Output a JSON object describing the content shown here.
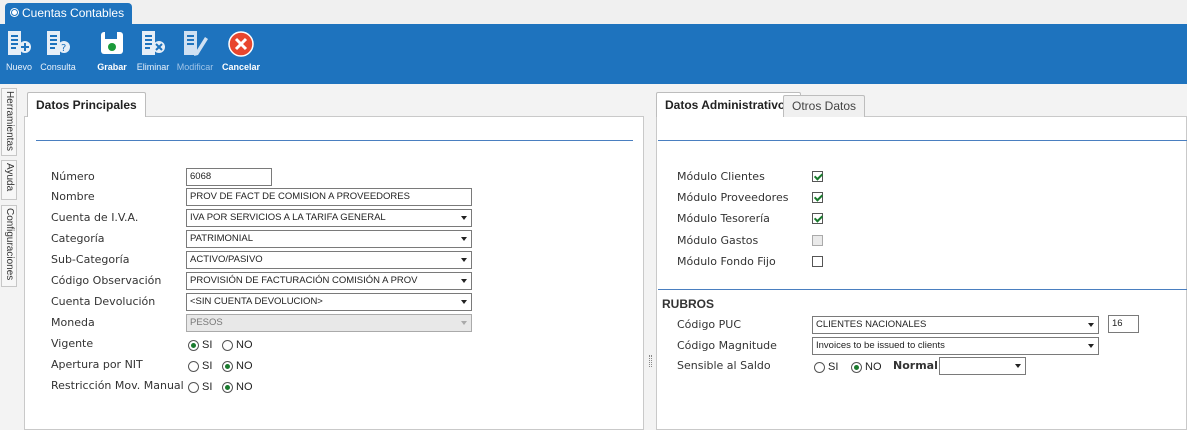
{
  "app": {
    "tab_title": "Cuentas Contables"
  },
  "toolbar": {
    "nuevo": "Nuevo",
    "consulta": "Consulta",
    "grabar": "Grabar",
    "eliminar": "Eliminar",
    "modificar": "Modificar",
    "cancelar": "Cancelar"
  },
  "side_tabs": {
    "herramientas": "Herramientas",
    "ayuda": "Ayuda",
    "configuraciones": "Configuraciones"
  },
  "left": {
    "tab": "Datos Principales",
    "labels": {
      "numero": "Número",
      "nombre": "Nombre",
      "cuenta_iva": "Cuenta de I.V.A.",
      "categoria": "Categoría",
      "subcategoria": "Sub-Categoría",
      "codigo_observacion": "Código Observación",
      "cuenta_devolucion": "Cuenta Devolución",
      "moneda": "Moneda",
      "vigente": "Vigente",
      "apertura_nit": "Apertura por NIT",
      "restriccion": "Restricción Mov. Manual"
    },
    "values": {
      "numero": "6068",
      "nombre": "PROV DE FACT DE COMISION A PROVEEDORES",
      "cuenta_iva": "IVA POR SERVICIOS A LA TARIFA GENERAL",
      "categoria": "PATRIMONIAL",
      "subcategoria": "ACTIVO/PASIVO",
      "codigo_observacion": "PROVISIÓN DE FACTURACIÓN COMISIÓN A PROV",
      "cuenta_devolucion": "<SIN CUENTA DEVOLUCION>",
      "moneda": "PESOS"
    },
    "radio_si": "SI",
    "radio_no": "NO"
  },
  "right": {
    "tab_active": "Datos Administrativos",
    "tab_inactive": "Otros Datos",
    "modules": {
      "clientes": "Módulo Clientes",
      "proveedores": "Módulo Proveedores",
      "tesoreria": "Módulo Tesorería",
      "gastos": "Módulo Gastos",
      "fondo_fijo": "Módulo Fondo Fijo"
    },
    "rubros": {
      "title": "RUBROS",
      "codigo_puc_label": "Código PUC",
      "codigo_puc_value": "CLIENTES NACIONALES",
      "codigo_puc_code": "16",
      "codigo_magnitude_label": "Código Magnitude",
      "codigo_magnitude_value": "Invoices to be issued to clients",
      "sensible_label": "Sensible al Saldo",
      "normal_label": "Normal",
      "normal_value": ""
    }
  },
  "colors": {
    "ribbon": "#1e73be",
    "accent_line": "#4a7fc0",
    "check": "#1a7a2e"
  }
}
